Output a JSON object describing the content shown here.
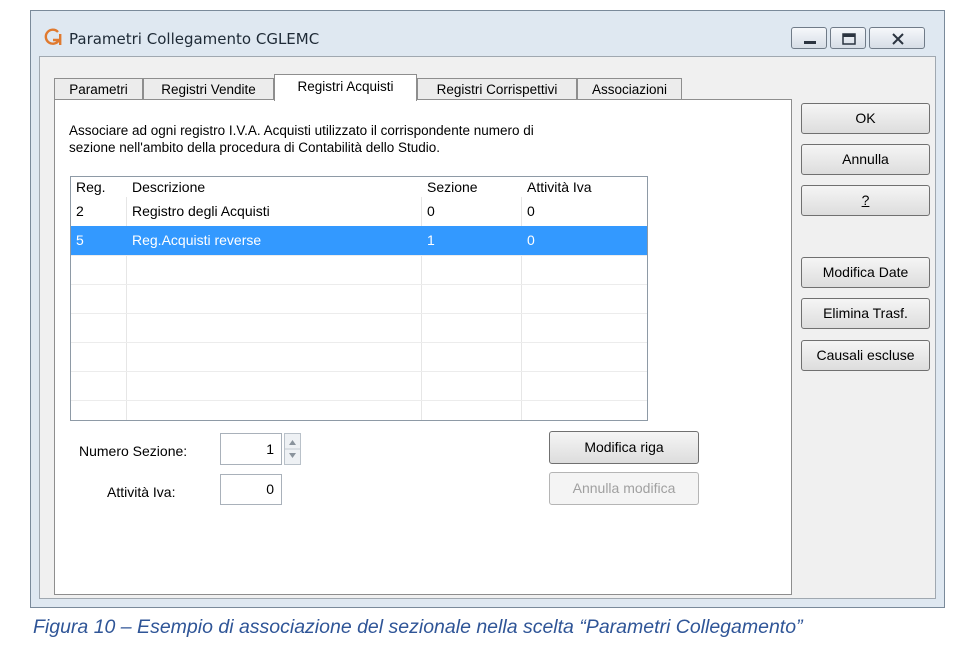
{
  "window": {
    "title": "Parametri Collegamento CGLEMC",
    "logo_color": "#e07a2f"
  },
  "tabs": [
    {
      "label": "Parametri"
    },
    {
      "label": "Registri Vendite"
    },
    {
      "label": "Registri Acquisti",
      "active": true
    },
    {
      "label": "Registri Corrispettivi"
    },
    {
      "label": "Associazioni"
    }
  ],
  "panel": {
    "description_line1": "Associare ad ogni registro I.V.A. Acquisti utilizzato il corrispondente numero di",
    "description_line2": "sezione nell'ambito della procedura di Contabilità dello Studio.",
    "table": {
      "headers": [
        "Reg.",
        "Descrizione",
        "Sezione",
        "Attività Iva"
      ],
      "rows": [
        [
          "2",
          "Registro degli Acquisti",
          "0",
          "0"
        ],
        [
          "5",
          "Reg.Acquisti reverse",
          "1",
          "0"
        ]
      ],
      "selected_row": 1,
      "selection_color": "#3399ff"
    },
    "numero_sezione_label": "Numero Sezione:",
    "numero_sezione_value": "1",
    "attivita_iva_label": "Attività Iva:",
    "attivita_iva_value": "0",
    "modifica_riga_label": "Modifica riga",
    "annulla_modifica_label": "Annulla modifica"
  },
  "side_buttons": {
    "ok": "OK",
    "annulla": "Annulla",
    "help": "?",
    "modifica_date": "Modifica Date",
    "elimina_trasf": "Elimina Trasf.",
    "causali_escluse": "Causali escluse"
  },
  "caption": "Figura 10 – Esempio di associazione del sezionale nella scelta “Parametri Collegamento”"
}
